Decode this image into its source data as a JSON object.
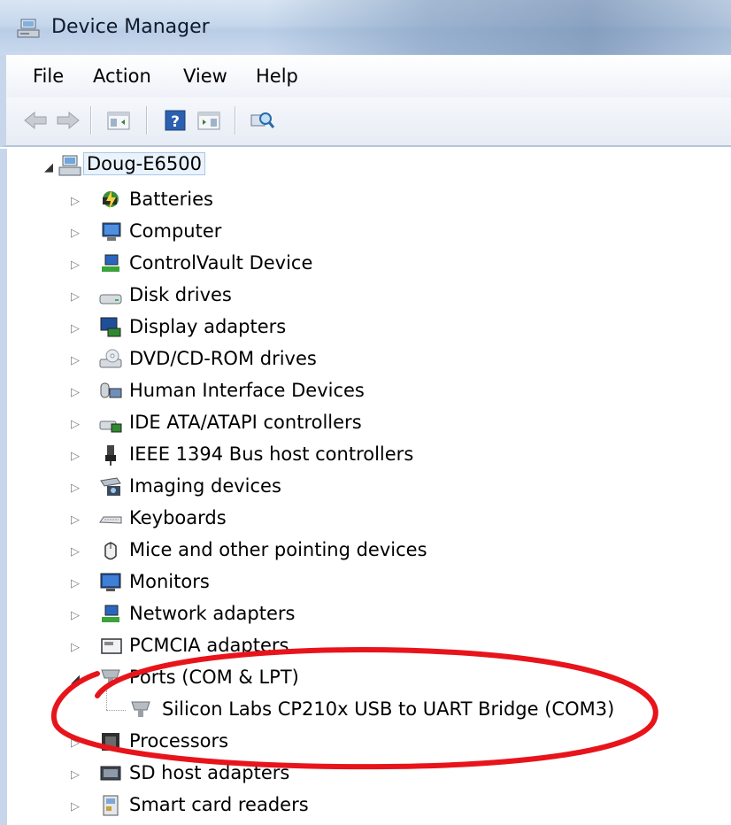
{
  "window": {
    "title": "Device Manager",
    "icon": "device-manager-icon"
  },
  "menubar": {
    "items": [
      "File",
      "Action",
      "View",
      "Help"
    ]
  },
  "toolbar": {
    "buttons": [
      "back-arrow-icon",
      "forward-arrow-icon",
      "show-hide-console-tree-icon",
      "help-icon",
      "show-hide-action-pane-icon",
      "scan-for-hardware-changes-icon"
    ]
  },
  "tree": {
    "root": {
      "label": "Doug-E6500",
      "icon": "computer-icon"
    },
    "categories": [
      {
        "label": "Batteries",
        "icon": "battery-icon"
      },
      {
        "label": "Computer",
        "icon": "computer-icon"
      },
      {
        "label": "ControlVault Device",
        "icon": "network-device-icon"
      },
      {
        "label": "Disk drives",
        "icon": "disk-drive-icon"
      },
      {
        "label": "Display adapters",
        "icon": "display-adapter-icon"
      },
      {
        "label": "DVD/CD-ROM drives",
        "icon": "dvd-drive-icon"
      },
      {
        "label": "Human Interface Devices",
        "icon": "hid-icon"
      },
      {
        "label": "IDE ATA/ATAPI controllers",
        "icon": "ide-controller-icon"
      },
      {
        "label": "IEEE 1394 Bus host controllers",
        "icon": "ieee1394-icon"
      },
      {
        "label": "Imaging devices",
        "icon": "camera-icon"
      },
      {
        "label": "Keyboards",
        "icon": "keyboard-icon"
      },
      {
        "label": "Mice and other pointing devices",
        "icon": "mouse-icon"
      },
      {
        "label": "Monitors",
        "icon": "monitor-icon"
      },
      {
        "label": "Network adapters",
        "icon": "network-adapter-icon"
      },
      {
        "label": "PCMCIA adapters",
        "icon": "pcmcia-icon"
      },
      {
        "label": "Ports (COM & LPT)",
        "icon": "port-icon",
        "expanded": true,
        "children": [
          {
            "label": "Silicon Labs CP210x USB to UART Bridge (COM3)",
            "icon": "port-icon"
          }
        ]
      },
      {
        "label": "Processors",
        "icon": "processor-icon"
      },
      {
        "label": "SD host adapters",
        "icon": "sd-adapter-icon"
      },
      {
        "label": "Smart card readers",
        "icon": "smart-card-icon"
      }
    ]
  },
  "annotation": {
    "shape": "ellipse",
    "color": "#e8141b"
  }
}
